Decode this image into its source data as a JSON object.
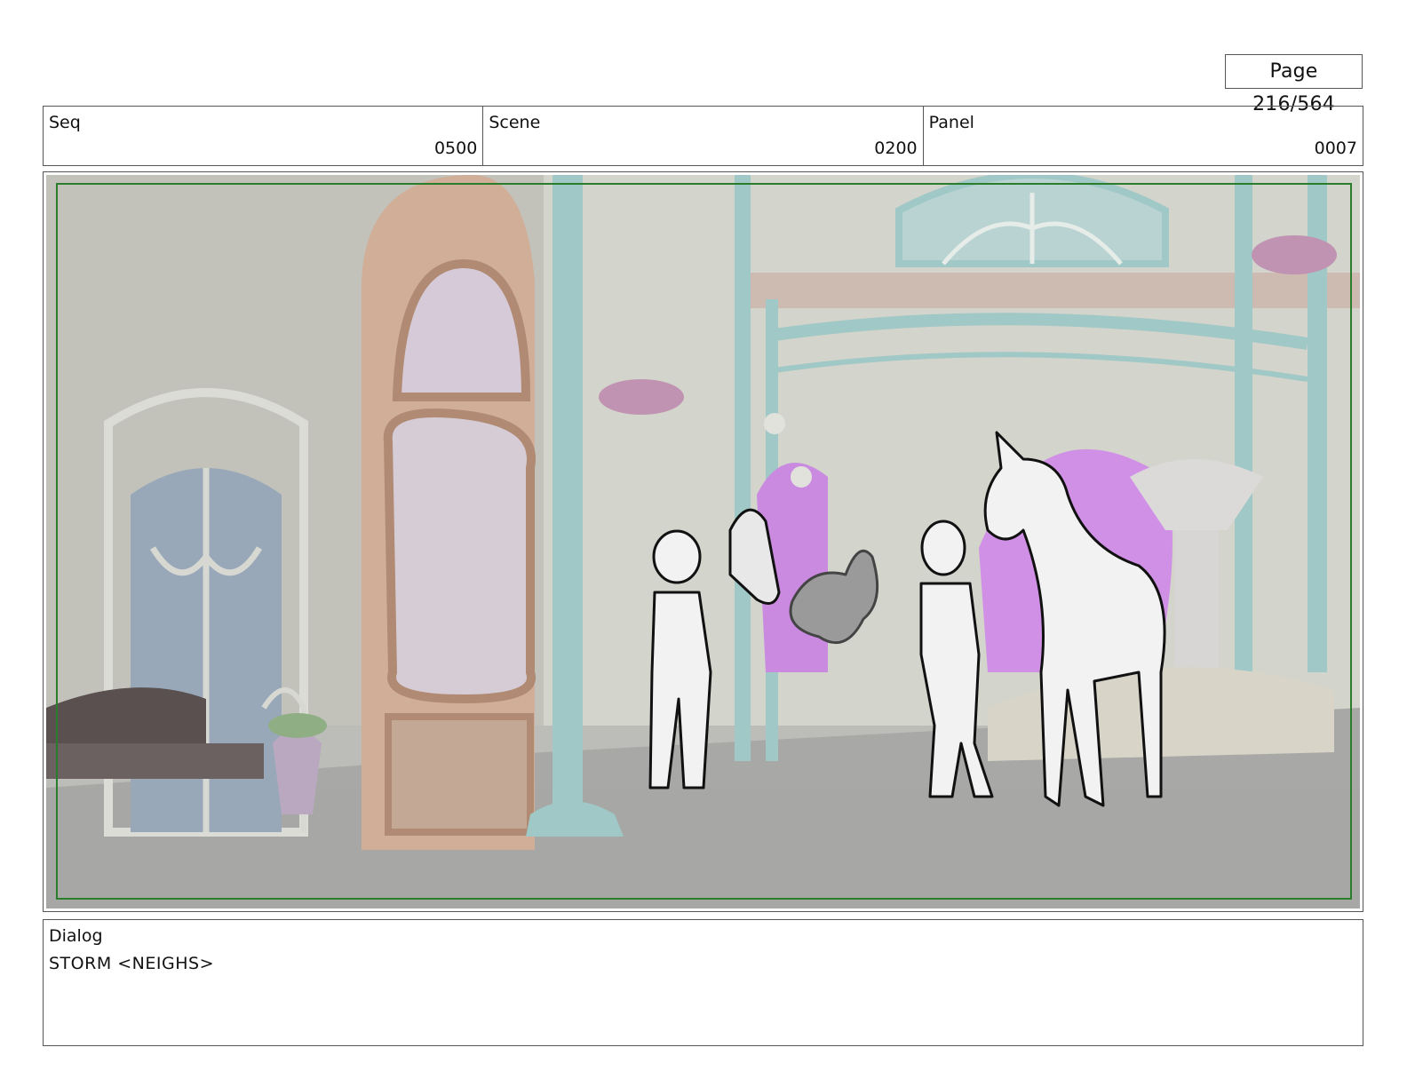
{
  "page": {
    "label": "Page 216/564"
  },
  "header": {
    "seq": {
      "label": "Seq",
      "value": "0500"
    },
    "scene": {
      "label": "Scene",
      "value": "0200"
    },
    "panel": {
      "label": "Panel",
      "value": "0007"
    }
  },
  "dialog": {
    "label": "Dialog",
    "text": "STORM <NEIGHS>"
  },
  "colors": {
    "border": "#555555",
    "safe_frame": "#2a7d2a",
    "wall": "#c4c4bc",
    "floor": "#a9a9a7",
    "door": "#d1b09c",
    "teal_metal": "#9fc8c6",
    "portal": "#c98ae0"
  }
}
